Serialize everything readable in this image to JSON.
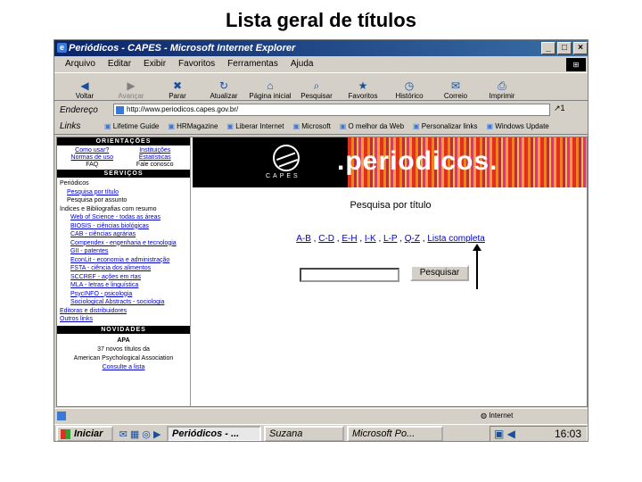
{
  "slide": {
    "title": "Lista geral de títulos"
  },
  "window": {
    "title": "Periódicos - CAPES - Microsoft Internet Explorer",
    "buttons": {
      "minimize": "_",
      "maximize": "□",
      "close": "×"
    }
  },
  "menu": {
    "items": [
      "Arquivo",
      "Editar",
      "Exibir",
      "Favoritos",
      "Ferramentas",
      "Ajuda"
    ]
  },
  "toolbar": {
    "buttons": [
      {
        "label": "Voltar",
        "glyph": "◀"
      },
      {
        "label": "Avançar",
        "glyph": "▶"
      },
      {
        "label": "Parar",
        "glyph": "✖"
      },
      {
        "label": "Atualizar",
        "glyph": "↻"
      },
      {
        "label": "Página inicial",
        "glyph": "⌂"
      },
      {
        "label": "Pesquisar",
        "glyph": "⌕"
      },
      {
        "label": "Favoritos",
        "glyph": "★"
      },
      {
        "label": "Histórico",
        "glyph": "◷"
      },
      {
        "label": "Correio",
        "glyph": "✉"
      },
      {
        "label": "Imprimir",
        "glyph": "⎙"
      }
    ]
  },
  "address": {
    "label": "Endereço",
    "url": "http://www.periodicos.capes.gov.br/",
    "go": "↗1"
  },
  "links": {
    "label": "Links",
    "items": [
      "Lifetime Guide",
      "HRMagazine",
      "Liberar Internet",
      "Microsoft",
      "O melhor da Web",
      "Personalizar links",
      "Windows Update"
    ]
  },
  "sidebar": {
    "orientacoes_header": "ORIENTAÇÕES",
    "orientacoes": [
      {
        "label": "Como usar?",
        "link": true
      },
      {
        "label": "Instituições",
        "link": true
      },
      {
        "label": "Normas de uso",
        "link": true
      },
      {
        "label": "Estatísticas",
        "link": true
      },
      {
        "label": "FAQ",
        "link": false
      },
      {
        "label": "Fale conosco",
        "link": false
      }
    ],
    "servicos_header": "SERVIÇOS",
    "servicos": [
      {
        "label": "Periódicos",
        "link": false,
        "indent": 0
      },
      {
        "label": "Pesquisa por título",
        "link": true,
        "indent": 1
      },
      {
        "label": "Pesquisa por assunto",
        "link": false,
        "indent": 1
      },
      {
        "label": "Índices e Bibliografias com resumo",
        "link": false,
        "indent": 0
      },
      {
        "label": "Web of Science - todas as áreas",
        "link": true,
        "indent": 2
      },
      {
        "label": "BIOSIS - ciências biológicas",
        "link": true,
        "indent": 2
      },
      {
        "label": "CAB - ciências agrárias",
        "link": true,
        "indent": 2
      },
      {
        "label": "Compendex - engenharia e tecnologia",
        "link": true,
        "indent": 2
      },
      {
        "label": "GII - patentes",
        "link": true,
        "indent": 2
      },
      {
        "label": "EconLit - economia e administração",
        "link": true,
        "indent": 2
      },
      {
        "label": "FSTA - ciência dos alimentos",
        "link": true,
        "indent": 2
      },
      {
        "label": "SCCREF - ações em rtas",
        "link": true,
        "indent": 2
      },
      {
        "label": "MLA - letras e linguística",
        "link": true,
        "indent": 2
      },
      {
        "label": "PsycINFO - psicologia",
        "link": true,
        "indent": 2
      },
      {
        "label": "Sociological Abstracts - sociologia",
        "link": true,
        "indent": 2
      },
      {
        "label": "Editoras e distribuidores",
        "link": true,
        "indent": 0
      },
      {
        "label": "Outros links",
        "link": true,
        "indent": 0
      }
    ],
    "novidades_header": "NOVIDADES",
    "novidades": {
      "title": "APA",
      "line1": "37 novos títulos da",
      "line2": "American Psychological Association",
      "line3": "Consulte a lista"
    }
  },
  "main": {
    "capes_text": "CAPES",
    "brand": ".periodicos.",
    "page_title": "Pesquisa por título",
    "letters": [
      "A-B",
      "C-D",
      "E-H",
      "I-K",
      "L-P",
      "Q-Z",
      "Lista completa"
    ],
    "search_button": "Pesquisar",
    "search_value": ""
  },
  "status": {
    "zone": "Internet"
  },
  "taskbar": {
    "start": "Iniciar",
    "quick_icons": "✉ ▦ ◎ ▶",
    "tasks": [
      {
        "label": "Periódicos - ...",
        "active": true
      },
      {
        "label": "Suzana",
        "active": false
      },
      {
        "label": "Microsoft Po...",
        "active": false
      }
    ],
    "tray_icons": "▣ ◀",
    "clock": "16:03"
  }
}
